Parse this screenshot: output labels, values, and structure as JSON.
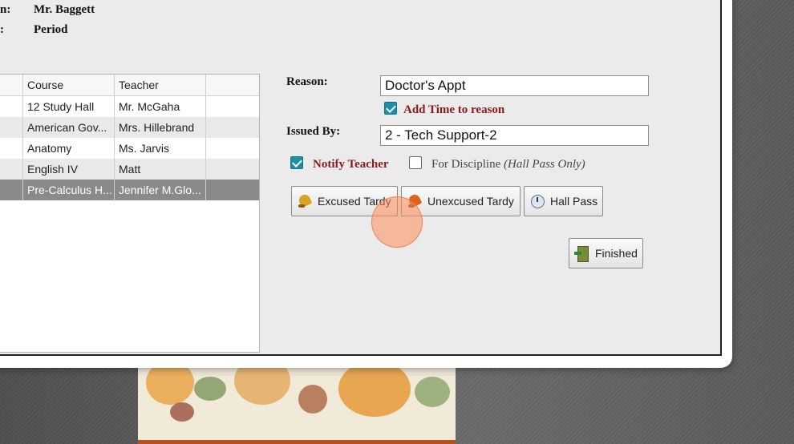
{
  "info": {
    "row1": {
      "label": "n:",
      "value": "Mr. Baggett"
    },
    "row2": {
      "label": ":",
      "value": "Period"
    }
  },
  "schedule": {
    "headers": [
      "",
      "Course",
      "Teacher",
      ""
    ],
    "rows": [
      {
        "course": "12 Study Hall",
        "teacher": "Mr. McGaha"
      },
      {
        "course": "American Gov...",
        "teacher": "Mrs. Hillebrand"
      },
      {
        "course": "Anatomy",
        "teacher": "Ms. Jarvis"
      },
      {
        "course": "English IV",
        "teacher": "Matt"
      },
      {
        "course": "Pre-Calculus H...",
        "teacher": "Jennifer M.Glo..."
      }
    ]
  },
  "form": {
    "reason_label": "Reason:",
    "reason_value": "Doctor's Appt",
    "add_time_label": "Add Time to reason",
    "add_time_checked": true,
    "issued_by_label": "Issued By:",
    "issued_by_value": "2 - Tech Support-2",
    "notify_teacher_label": "Notify Teacher",
    "notify_teacher_checked": true,
    "discipline_label": "For Discipline",
    "discipline_note": "(Hall Pass Only)",
    "discipline_checked": false
  },
  "buttons": {
    "excused": {
      "label": "Excused Tardy",
      "icon": "bell-icon"
    },
    "unexcused": {
      "label": "Unexcused Tardy",
      "icon": "bell-icon"
    },
    "hall_pass": {
      "label": "Hall Pass",
      "icon": "clock-icon"
    },
    "finished": {
      "label": "Finished",
      "icon": "exit-door-icon"
    }
  },
  "colors": {
    "accent_check": "#1e8fa8",
    "label_red": "#8b1a1a",
    "selected_row": "#8a8a8a"
  }
}
